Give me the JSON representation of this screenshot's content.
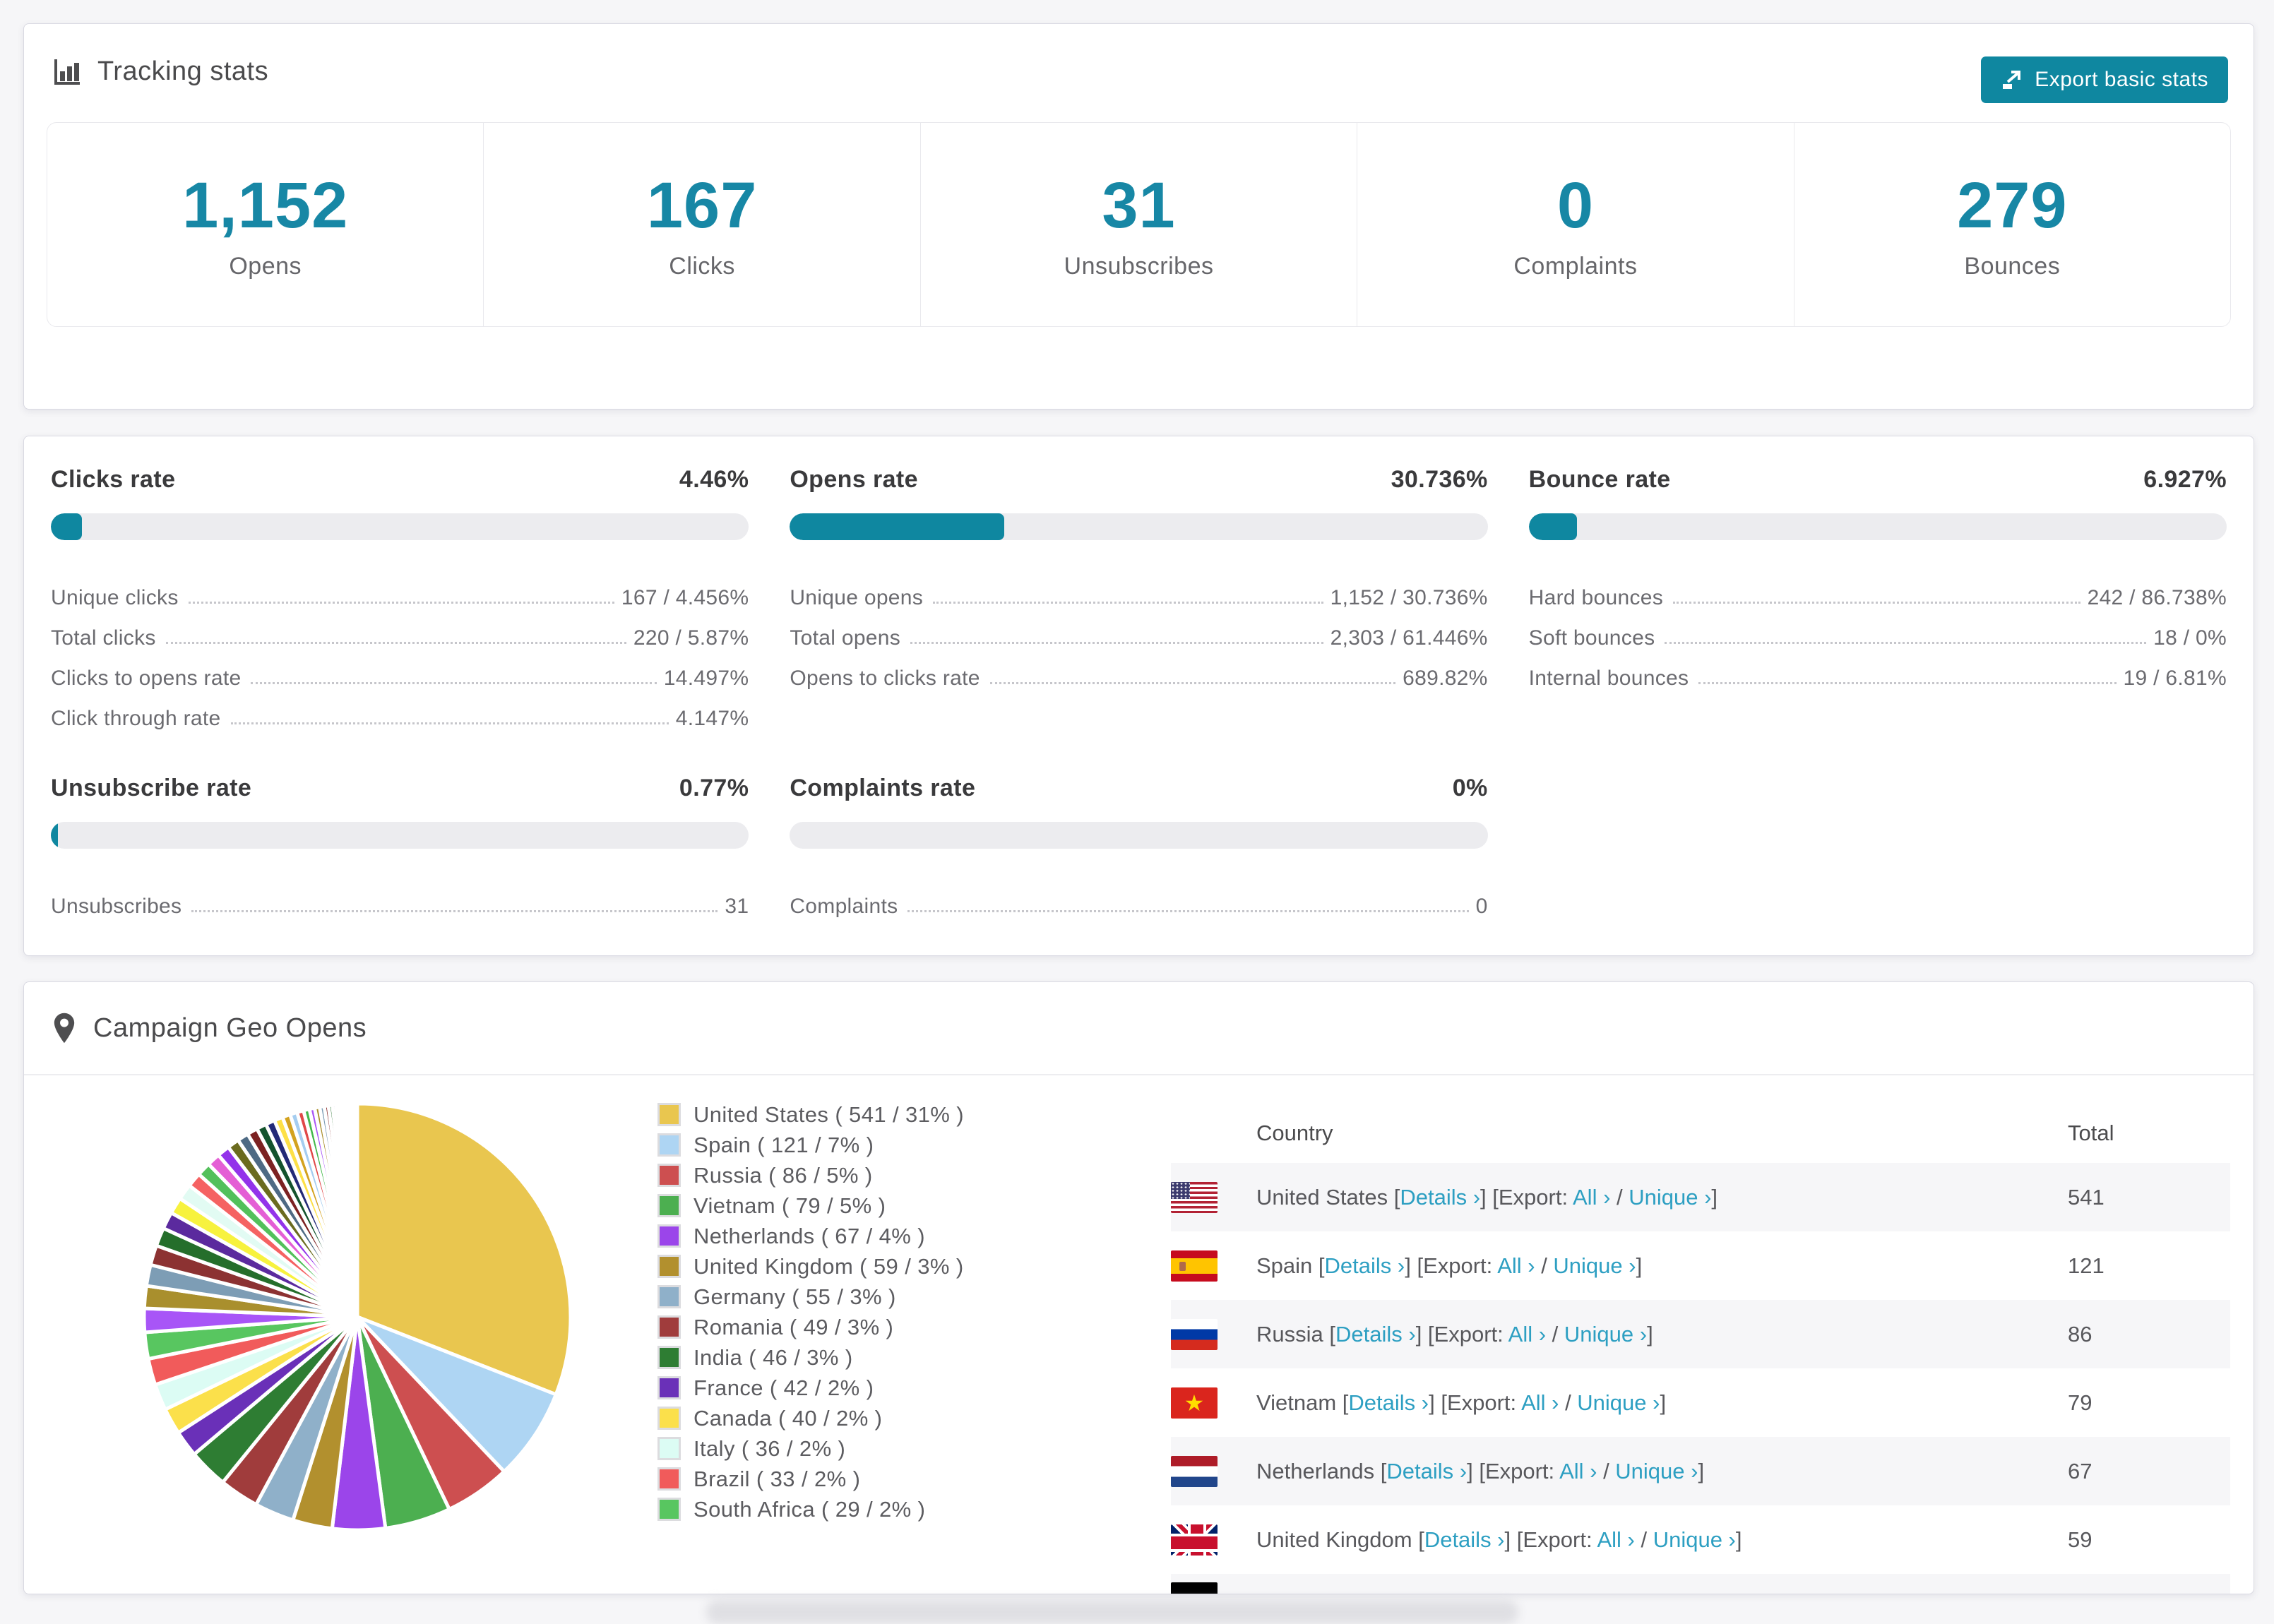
{
  "accent": "#0f87a0",
  "link_color": "#2d9fc2",
  "tracking": {
    "title": "Tracking stats",
    "export_label": "Export basic stats",
    "stats": [
      {
        "value": "1,152",
        "label": "Opens"
      },
      {
        "value": "167",
        "label": "Clicks"
      },
      {
        "value": "31",
        "label": "Unsubscribes"
      },
      {
        "value": "0",
        "label": "Complaints"
      },
      {
        "value": "279",
        "label": "Bounces"
      }
    ]
  },
  "rates": [
    {
      "title": "Clicks rate",
      "value": "4.46%",
      "pct": 4.46,
      "rows": [
        [
          "Unique clicks",
          "167 / 4.456%"
        ],
        [
          "Total clicks",
          "220 / 5.87%"
        ],
        [
          "Clicks to opens rate",
          "14.497%"
        ],
        [
          "Click through rate",
          "4.147%"
        ]
      ]
    },
    {
      "title": "Opens rate",
      "value": "30.736%",
      "pct": 30.736,
      "rows": [
        [
          "Unique opens",
          "1,152 / 30.736%"
        ],
        [
          "Total opens",
          "2,303 / 61.446%"
        ],
        [
          "Opens to clicks rate",
          "689.82%"
        ]
      ]
    },
    {
      "title": "Bounce rate",
      "value": "6.927%",
      "pct": 6.927,
      "rows": [
        [
          "Hard bounces",
          "242 / 86.738%"
        ],
        [
          "Soft bounces",
          "18 / 0%"
        ],
        [
          "Internal bounces",
          "19 / 6.81%"
        ]
      ]
    },
    {
      "title": "Unsubscribe rate",
      "value": "0.77%",
      "pct": 0.77,
      "rows": [
        [
          "Unsubscribes",
          "31"
        ]
      ]
    },
    {
      "title": "Complaints rate",
      "value": "0%",
      "pct": 0,
      "rows": [
        [
          "Complaints",
          "0"
        ]
      ]
    }
  ],
  "geo": {
    "title": "Campaign Geo Opens",
    "table_headers": {
      "country": "Country",
      "total": "Total"
    },
    "links": {
      "details": "Details ›",
      "export_prefix": "[Export:",
      "all": "All ›",
      "slash": "/",
      "unique": "Unique ›"
    },
    "rows": [
      {
        "flag": "us",
        "country": "United States",
        "total": "541"
      },
      {
        "flag": "es",
        "country": "Spain",
        "total": "121"
      },
      {
        "flag": "ru",
        "country": "Russia",
        "total": "86"
      },
      {
        "flag": "vn",
        "country": "Vietnam",
        "total": "79"
      },
      {
        "flag": "nl",
        "country": "Netherlands",
        "total": "67"
      },
      {
        "flag": "gb",
        "country": "United Kingdom",
        "total": "59"
      },
      {
        "flag": "de",
        "country": "",
        "total": "",
        "partial": true
      }
    ]
  },
  "chart_data": {
    "type": "pie",
    "title": "Campaign Geo Opens",
    "legend_position": "right",
    "start_angle_deg": -90,
    "direction": "clockwise",
    "slices": [
      {
        "label": "United States",
        "value": 541,
        "pct": 31,
        "color": "#e9c64f"
      },
      {
        "label": "Spain",
        "value": 121,
        "pct": 7,
        "color": "#aed5f3"
      },
      {
        "label": "Russia",
        "value": 86,
        "pct": 5,
        "color": "#cd4f50"
      },
      {
        "label": "Vietnam",
        "value": 79,
        "pct": 5,
        "color": "#4caf50"
      },
      {
        "label": "Netherlands",
        "value": 67,
        "pct": 4,
        "color": "#9b45ea"
      },
      {
        "label": "United Kingdom",
        "value": 59,
        "pct": 3,
        "color": "#b2902e"
      },
      {
        "label": "Germany",
        "value": 55,
        "pct": 3,
        "color": "#8fb0c9"
      },
      {
        "label": "Romania",
        "value": 49,
        "pct": 3,
        "color": "#a03c3c"
      },
      {
        "label": "India",
        "value": 46,
        "pct": 3,
        "color": "#2e7d33"
      },
      {
        "label": "France",
        "value": 42,
        "pct": 2,
        "color": "#6a30b8"
      },
      {
        "label": "Canada",
        "value": 40,
        "pct": 2,
        "color": "#fbe04b"
      },
      {
        "label": "Italy",
        "value": 36,
        "pct": 2,
        "color": "#dcfcf4"
      },
      {
        "label": "Brazil",
        "value": 33,
        "pct": 2,
        "color": "#f15b5b"
      },
      {
        "label": "South Africa",
        "value": 29,
        "pct": 2,
        "color": "#58c660"
      }
    ],
    "other_slices": {
      "note": "unlabeled small countries, not in legend",
      "values": [
        1.8,
        1.7,
        1.6,
        1.5,
        1.4,
        1.3,
        1.25,
        1.2,
        1.1,
        1.05,
        1.0,
        0.95,
        0.9,
        0.85,
        0.8,
        0.75,
        0.7,
        0.65,
        0.6,
        0.55,
        0.5,
        0.45,
        0.4,
        0.38,
        0.35,
        0.32,
        0.3,
        0.27,
        0.25,
        0.22,
        0.2,
        0.18,
        0.15,
        0.13,
        0.11,
        0.1,
        0.08,
        0.07,
        0.06,
        0.05
      ],
      "colors": [
        "#a855f7",
        "#a98f2d",
        "#7d9db5",
        "#8c3232",
        "#256e2b",
        "#5b2a9e",
        "#f7f23e",
        "#e2fbf3",
        "#f56262",
        "#53c05b",
        "#e45fd5",
        "#9333ea",
        "#6b6b1f",
        "#4e6a84",
        "#7c2222",
        "#14532d",
        "#232a77",
        "#fde047",
        "#d3a21f",
        "#a5cdf0",
        "#e04848",
        "#44b84c"
      ]
    }
  }
}
